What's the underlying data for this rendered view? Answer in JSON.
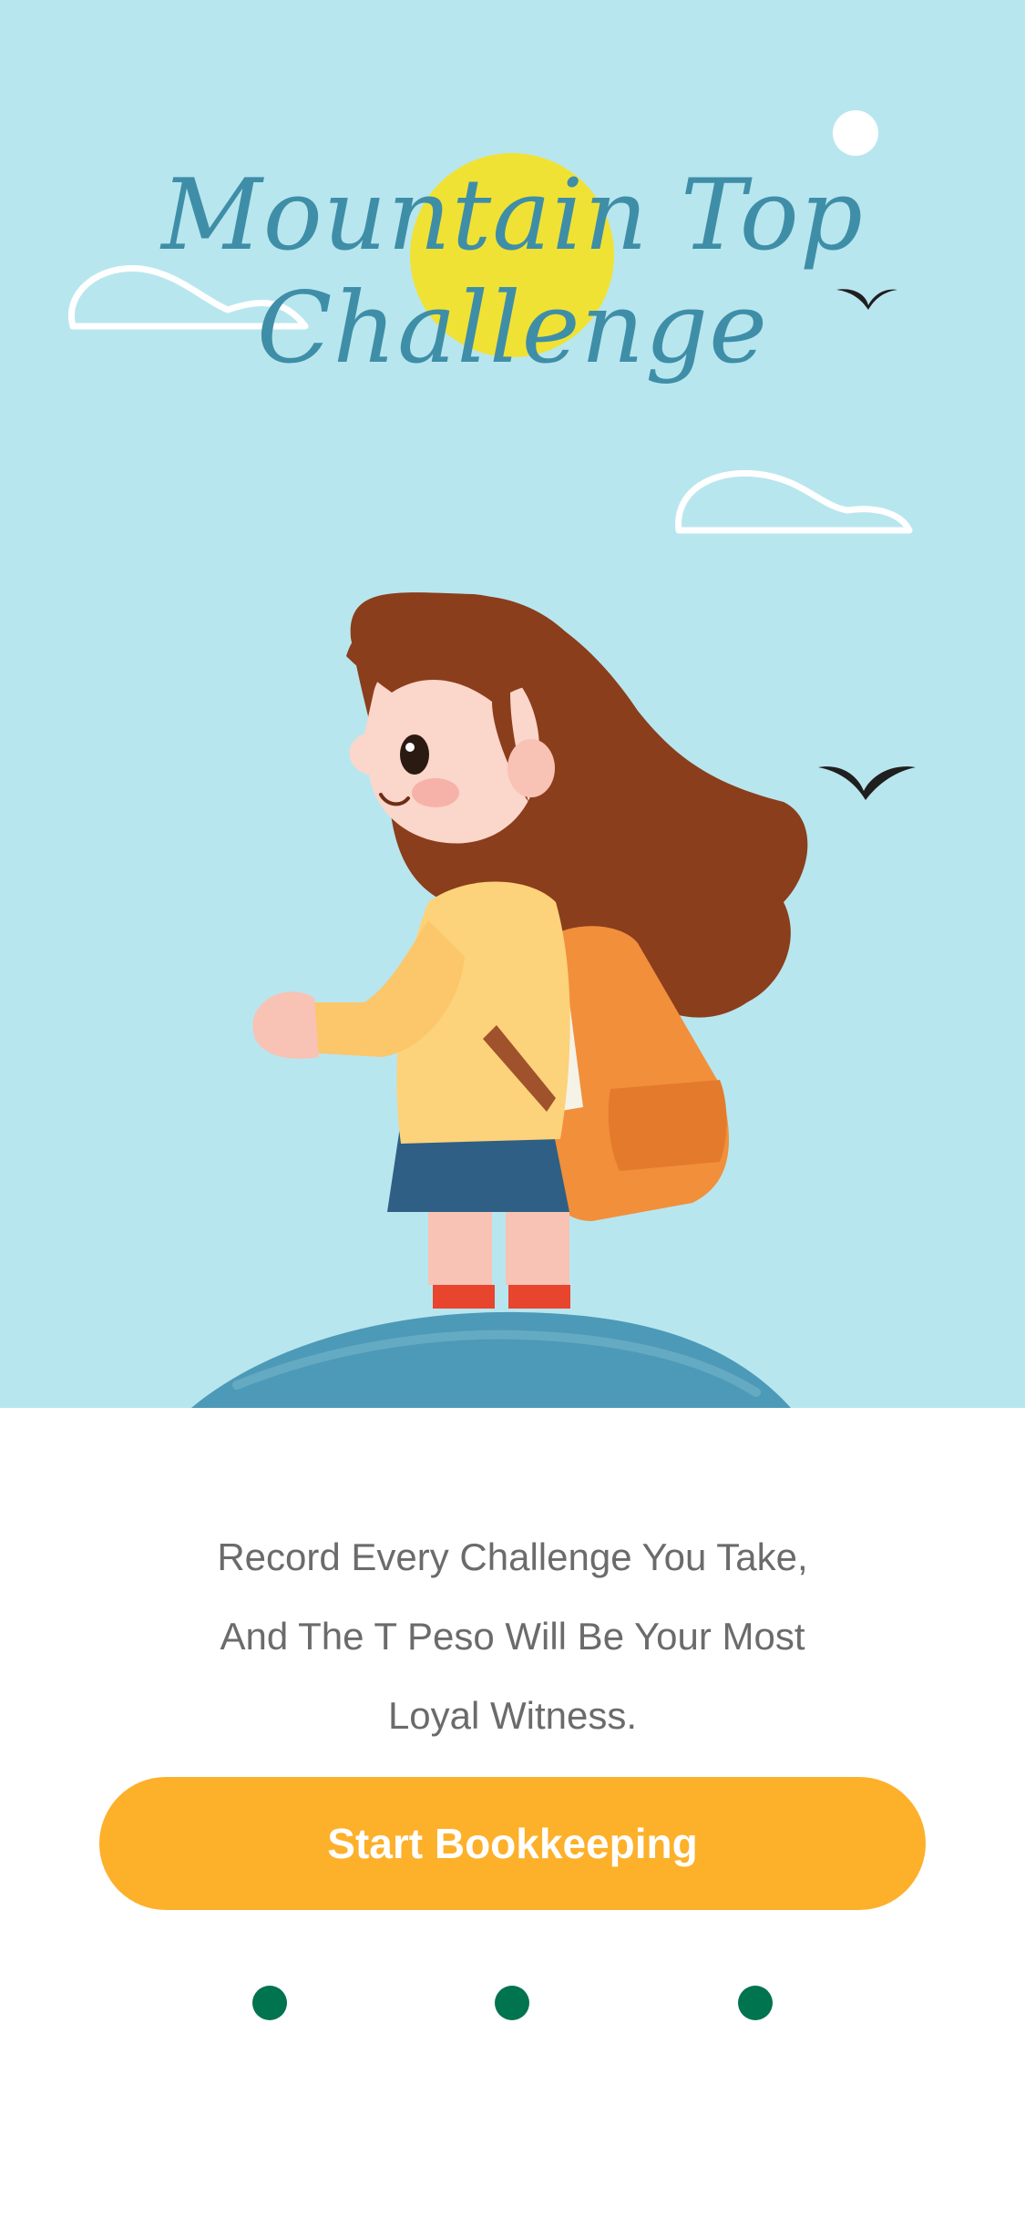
{
  "hero": {
    "title_lines": [
      "Mountain Top",
      "Challenge"
    ]
  },
  "onboarding": {
    "tagline_lines": [
      "Record Every Challenge You Take,",
      "And The T Peso Will Be Your Most",
      "Loyal Witness."
    ],
    "cta_label": "Start Bookkeeping"
  },
  "pagination": {
    "total": 3,
    "dot_color": "#00734f"
  },
  "colors": {
    "sky": "#b8e6ee",
    "title": "#3f8ea8",
    "sun": "#f0e234",
    "cta": "#fdb02a",
    "text": "#6b6b6b"
  }
}
